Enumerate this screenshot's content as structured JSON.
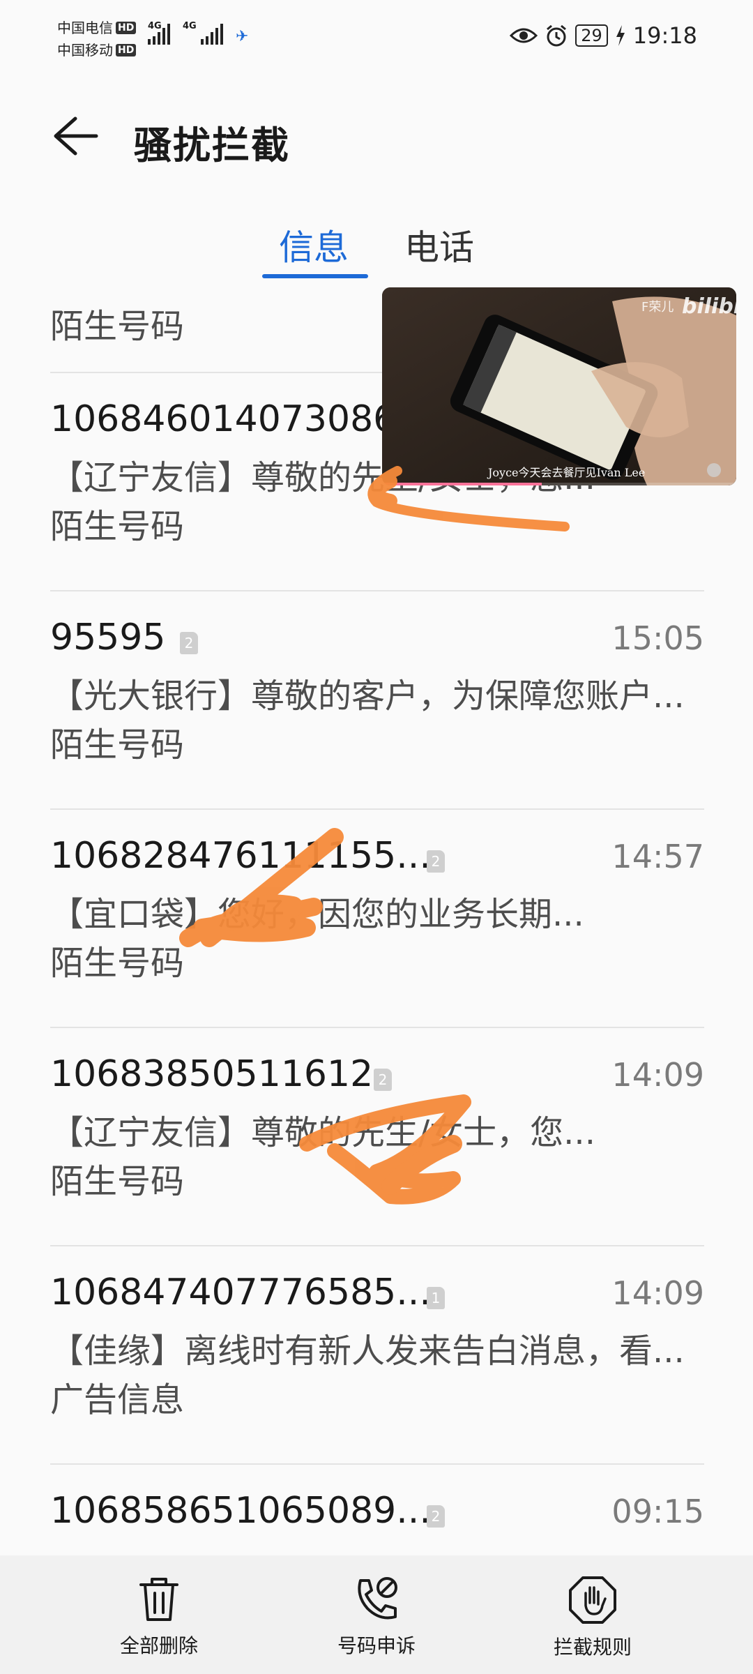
{
  "status_bar": {
    "carrier_1": "中国电信",
    "carrier_2": "中国移动",
    "hd_label": "HD",
    "network_type": "4G",
    "battery_level": "29",
    "time": "19:18"
  },
  "app_bar": {
    "title": "骚扰拦截"
  },
  "tabs": [
    {
      "label": "信息",
      "active": true
    },
    {
      "label": "电话",
      "active": false
    }
  ],
  "first_item_category": "陌生号码",
  "messages": [
    {
      "sender": "106846014073086...",
      "time": "",
      "sim": "",
      "preview": "【辽宁友信】尊敬的先生/女士，您...",
      "category": "陌生号码"
    },
    {
      "sender": "95595",
      "time": "15:05",
      "sim": "2",
      "preview": "【光大银行】尊敬的客户，为保障您账户...",
      "category": "陌生号码"
    },
    {
      "sender": "106828476111155...",
      "time": "14:57",
      "sim": "2",
      "preview": "【宜口袋】您好，因您的业务长期...",
      "category": "陌生号码"
    },
    {
      "sender": "10683850511612",
      "time": "14:09",
      "sim": "2",
      "preview": "【辽宁友信】尊敬的先生/女士，您...",
      "category": "陌生号码"
    },
    {
      "sender": "106847407776585...",
      "time": "14:09",
      "sim": "1",
      "preview": "【佳缘】离线时有新人发来告白消息，看...",
      "category": "广告信息"
    },
    {
      "sender": "106858651065089...",
      "time": "09:15",
      "sim": "2",
      "preview": "",
      "category": ""
    }
  ],
  "video_overlay": {
    "subtitle": "Joyce今天会去餐厅见Ivan Lee",
    "watermark": "bilibili",
    "channel": "F荣儿",
    "progress": 0.45,
    "progress_color": "#fb7299"
  },
  "toolbar": {
    "delete_all": "全部删除",
    "appeal_number": "号码申诉",
    "block_rules": "拦截规则"
  },
  "colors": {
    "accent": "#1d6ad7",
    "scribble": "#f58a3a"
  },
  "icons": [
    "back-arrow-icon",
    "trash-icon",
    "phone-appeal-icon",
    "hand-stop-icon",
    "eye-icon",
    "alarm-icon",
    "charging-icon",
    "sim-badge-icon"
  ]
}
